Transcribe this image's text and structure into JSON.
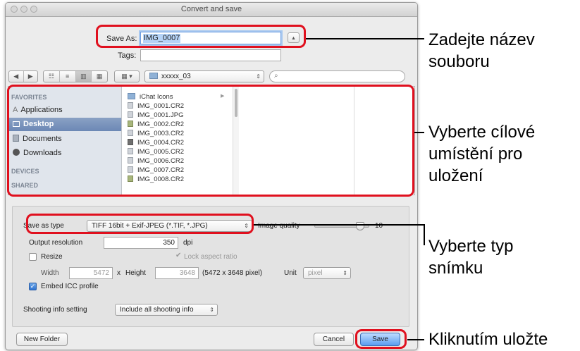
{
  "window": {
    "title": "Convert and save"
  },
  "save_as": {
    "label": "Save As:",
    "value": "IMG_0007",
    "expand_glyph": "▲"
  },
  "tags": {
    "label": "Tags:",
    "value": ""
  },
  "toolbar": {
    "back_glyph": "◀",
    "forward_glyph": "▶",
    "view_glyphs": [
      "☷",
      "≡",
      "▥",
      "▦"
    ],
    "arrange_glyph": "▦ ▾",
    "folder": "xxxxx_03",
    "search_placeholder": ""
  },
  "sidebar": {
    "favorites_header": "FAVORITES",
    "items": [
      {
        "label": "Applications",
        "icon": "applications-icon"
      },
      {
        "label": "Desktop",
        "icon": "desktop-icon",
        "selected": true
      },
      {
        "label": "Documents",
        "icon": "documents-icon"
      },
      {
        "label": "Downloads",
        "icon": "downloads-icon"
      }
    ],
    "devices_header": "DEVICES",
    "shared_header": "SHARED"
  },
  "files": [
    {
      "name": "iChat Icons",
      "kind": "folder"
    },
    {
      "name": "IMG_0001.CR2",
      "kind": "file"
    },
    {
      "name": "IMG_0001.JPG",
      "kind": "file"
    },
    {
      "name": "IMG_0002.CR2",
      "kind": "img"
    },
    {
      "name": "IMG_0003.CR2",
      "kind": "file"
    },
    {
      "name": "IMG_0004.CR2",
      "kind": "dark"
    },
    {
      "name": "IMG_0005.CR2",
      "kind": "file"
    },
    {
      "name": "IMG_0006.CR2",
      "kind": "file"
    },
    {
      "name": "IMG_0007.CR2",
      "kind": "file"
    },
    {
      "name": "IMG_0008.CR2",
      "kind": "img"
    }
  ],
  "options": {
    "save_type_label": "Save as type",
    "save_type_value": "TIFF 16bit + Exif-JPEG (*.TIF, *.JPG)",
    "image_quality_label": "Image quality",
    "image_quality_value": "10",
    "image_quality_fraction": 0.9,
    "output_resolution_label": "Output resolution",
    "output_resolution_value": "350",
    "output_resolution_unit": "dpi",
    "resize_label": "Resize",
    "resize_checked": false,
    "lock_aspect_label": "Lock aspect ratio",
    "lock_aspect_checked": true,
    "width_label": "Width",
    "width_value": "5472",
    "x_label": "x",
    "height_label": "Height",
    "height_value": "3648",
    "size_text": "(5472 x 3648 pixel)",
    "unit_label": "Unit",
    "unit_value": "pixel",
    "embed_icc_label": "Embed ICC profile",
    "embed_icc_checked": true,
    "shooting_info_label": "Shooting info setting",
    "shooting_info_value": "Include all shooting info"
  },
  "buttons": {
    "new_folder": "New Folder",
    "cancel": "Cancel",
    "save": "Save"
  },
  "callouts": {
    "filename": [
      "Zadejte název",
      "souboru"
    ],
    "location": [
      "Vyberte cílové",
      "umístění pro",
      "uložení"
    ],
    "type": [
      "Vyberte typ",
      "snímku"
    ],
    "save": "Kliknutím uložte"
  },
  "colors": {
    "annotation_red": "#e0101e",
    "selection_blue": "#6c88b5"
  }
}
